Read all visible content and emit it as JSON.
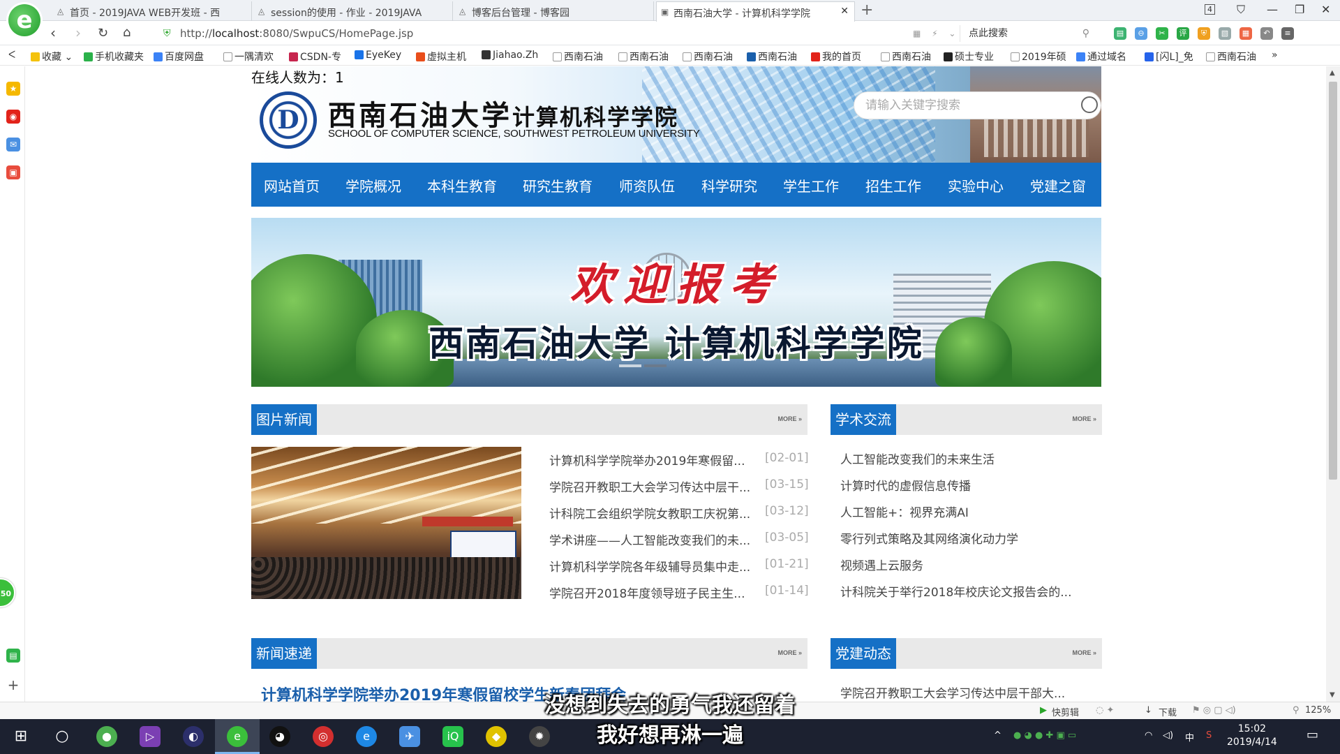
{
  "browser": {
    "tabs": [
      {
        "title": "首页 - 2019JAVA WEB开发班 - 西",
        "active": false
      },
      {
        "title": "session的使用 - 作业 - 2019JAVA",
        "active": false
      },
      {
        "title": "博客后台管理 - 博客园",
        "active": false
      },
      {
        "title": "西南石油大学 - 计算机科学学院",
        "active": true
      }
    ],
    "tab_count": "4",
    "url_scheme": "http://",
    "url_host": "localhost",
    "url_path": ":8080/SwpuCS/HomePage.jsp",
    "search_placeholder": "点此搜索",
    "bookmarks": [
      "收藏",
      "手机收藏夹",
      "百度网盘",
      "一隅清欢",
      "CSDN-专",
      "EyeKey",
      "虚拟主机",
      "Jiahao.Zh",
      "西南石油",
      "西南石油",
      "西南石油",
      "西南石油",
      "我的首页",
      "西南石油",
      "硕士专业",
      "2019年硕",
      "通过域名",
      "[闪L]_免",
      "西南石油"
    ]
  },
  "page": {
    "online_label": "在线人数为：",
    "online_count": "1",
    "school_cn": "西南石油大学",
    "college_cn": "计算机科学学院",
    "school_en": "SCHOOL OF COMPUTER SCIENCE, SOUTHWEST PETROLEUM UNIVERSITY",
    "search_placeholder": "请输入关键字搜索",
    "nav": [
      "网站首页",
      "学院概况",
      "本科生教育",
      "研究生教育",
      "师资队伍",
      "科学研究",
      "学生工作",
      "招生工作",
      "实验中心",
      "党建之窗"
    ],
    "banner_welcome": "欢迎报考",
    "banner_name": "西南石油大学 计算机科学学院",
    "more_label": "MORE »",
    "sections": {
      "photo_news": "图片新闻",
      "academic": "学术交流",
      "news_flash": "新闻速递",
      "party": "党建动态"
    },
    "photo_news": [
      {
        "title": "计算机科学学院举办2019年寒假留...",
        "date": "[02-01]"
      },
      {
        "title": "学院召开教职工大会学习传达中层干...",
        "date": "[03-15]"
      },
      {
        "title": "计科院工会组织学院女教职工庆祝第...",
        "date": "[03-12]"
      },
      {
        "title": "学术讲座——人工智能改变我们的未...",
        "date": "[03-05]"
      },
      {
        "title": "计算机科学学院各年级辅导员集中走...",
        "date": "[01-21]"
      },
      {
        "title": "学院召开2018年度领导班子民主生...",
        "date": "[01-14]"
      }
    ],
    "academic": [
      "人工智能改变我们的未来生活",
      "计算时代的虚假信息传播",
      "人工智能+：视界充满AI",
      "零行列式策略及其网络演化动力学",
      "视频遇上云服务",
      "计科院关于举行2018年校庆论文报告会的..."
    ],
    "news_headline": "计算机科学学院举办2019年寒假留校学生新春团拜会",
    "party_first": "学院召开教职工大会学习传达中层干部大..."
  },
  "status": {
    "quick_clip": "快剪辑",
    "download": "下载",
    "zoom": "125%"
  },
  "taskbar": {
    "time": "15:02",
    "date": "2019/4/14",
    "ime": "中",
    "subtitle_1": "没想到失去的勇气我还留着",
    "subtitle_2": "我好想再淋一遍"
  },
  "colors": {
    "accent_blue": "#1570c6",
    "date_gray": "#aaaaaa",
    "headline_blue": "#1a5fab"
  }
}
